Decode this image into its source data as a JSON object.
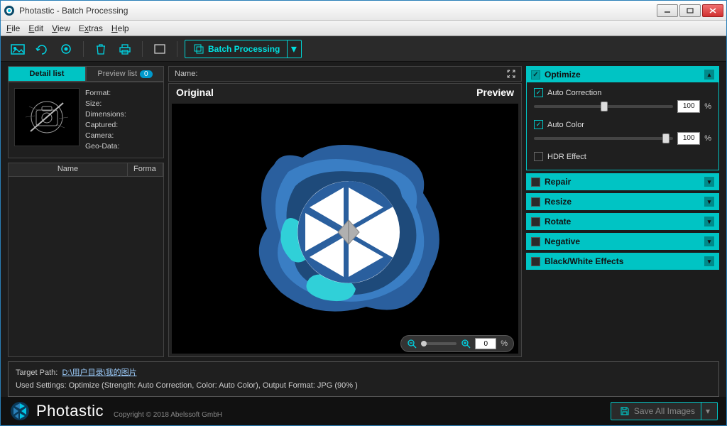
{
  "window": {
    "title": "Photastic - Batch Processing"
  },
  "menu": {
    "file": "File",
    "edit": "Edit",
    "view": "View",
    "extras": "Extras",
    "help": "Help"
  },
  "toolbar": {
    "batch_label": "Batch Processing"
  },
  "left": {
    "tab_detail": "Detail list",
    "tab_preview": "Preview list",
    "preview_count": "0",
    "meta": {
      "format": "Format:",
      "size": "Size:",
      "dimensions": "Dimensions:",
      "captured": "Captured:",
      "camera": "Camera:",
      "geodata": "Geo-Data:"
    },
    "col_name": "Name",
    "col_format": "Forma"
  },
  "center": {
    "name_label": "Name:",
    "original": "Original",
    "preview": "Preview",
    "zoom_value": "0",
    "zoom_unit": "%"
  },
  "right": {
    "optimize": {
      "title": "Optimize",
      "auto_correction": "Auto Correction",
      "auto_correction_val": "100",
      "auto_color": "Auto Color",
      "auto_color_val": "100",
      "hdr": "HDR Effect",
      "pct": "%"
    },
    "repair": "Repair",
    "resize": "Resize",
    "rotate": "Rotate",
    "negative": "Negative",
    "blackwhite": "Black/White Effects"
  },
  "bottom": {
    "target_label": "Target Path:",
    "target_path": "D:\\用户目录\\我的图片",
    "settings": "Used Settings: Optimize (Strength: Auto Correction, Color: Auto Color), Output Format: JPG (90% )"
  },
  "footer": {
    "brand": "Photastic",
    "copyright": "Copyright © 2018 Abelssoft GmbH",
    "save": "Save All Images"
  }
}
